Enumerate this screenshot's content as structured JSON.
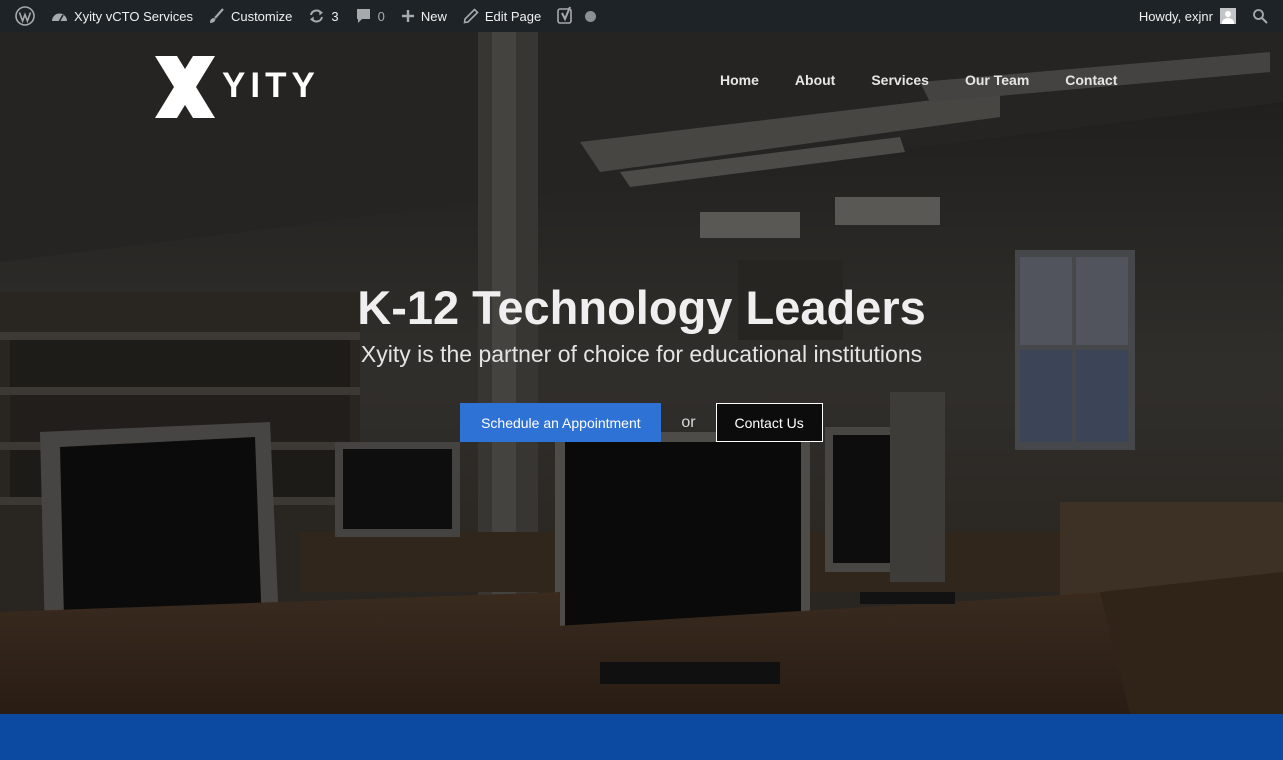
{
  "admin_bar": {
    "site_name": "Xyity vCTO Services",
    "customize": "Customize",
    "updates_count": "3",
    "comments_count": "0",
    "new_label": "New",
    "edit_page": "Edit Page",
    "greeting": "Howdy, exjnr"
  },
  "header": {
    "logo_text": "YITY",
    "nav": [
      "Home",
      "About",
      "Services",
      "Our Team",
      "Contact"
    ]
  },
  "hero": {
    "title": "K-12 Technology Leaders",
    "subtitle": "Xyity is the partner of choice for educational institutions",
    "primary_button": "Schedule an Appointment",
    "or_text": "or",
    "secondary_button": "Contact Us"
  },
  "colors": {
    "admin_bar": "#1d2327",
    "primary_button": "#2f72d6",
    "bottom_band": "#0b4aa0"
  },
  "icons": [
    "wordpress-icon",
    "dashboard-icon",
    "brush-icon",
    "updates-icon",
    "comment-icon",
    "plus-icon",
    "pencil-icon",
    "yoast-icon",
    "status-dot-icon",
    "avatar",
    "search-icon"
  ]
}
